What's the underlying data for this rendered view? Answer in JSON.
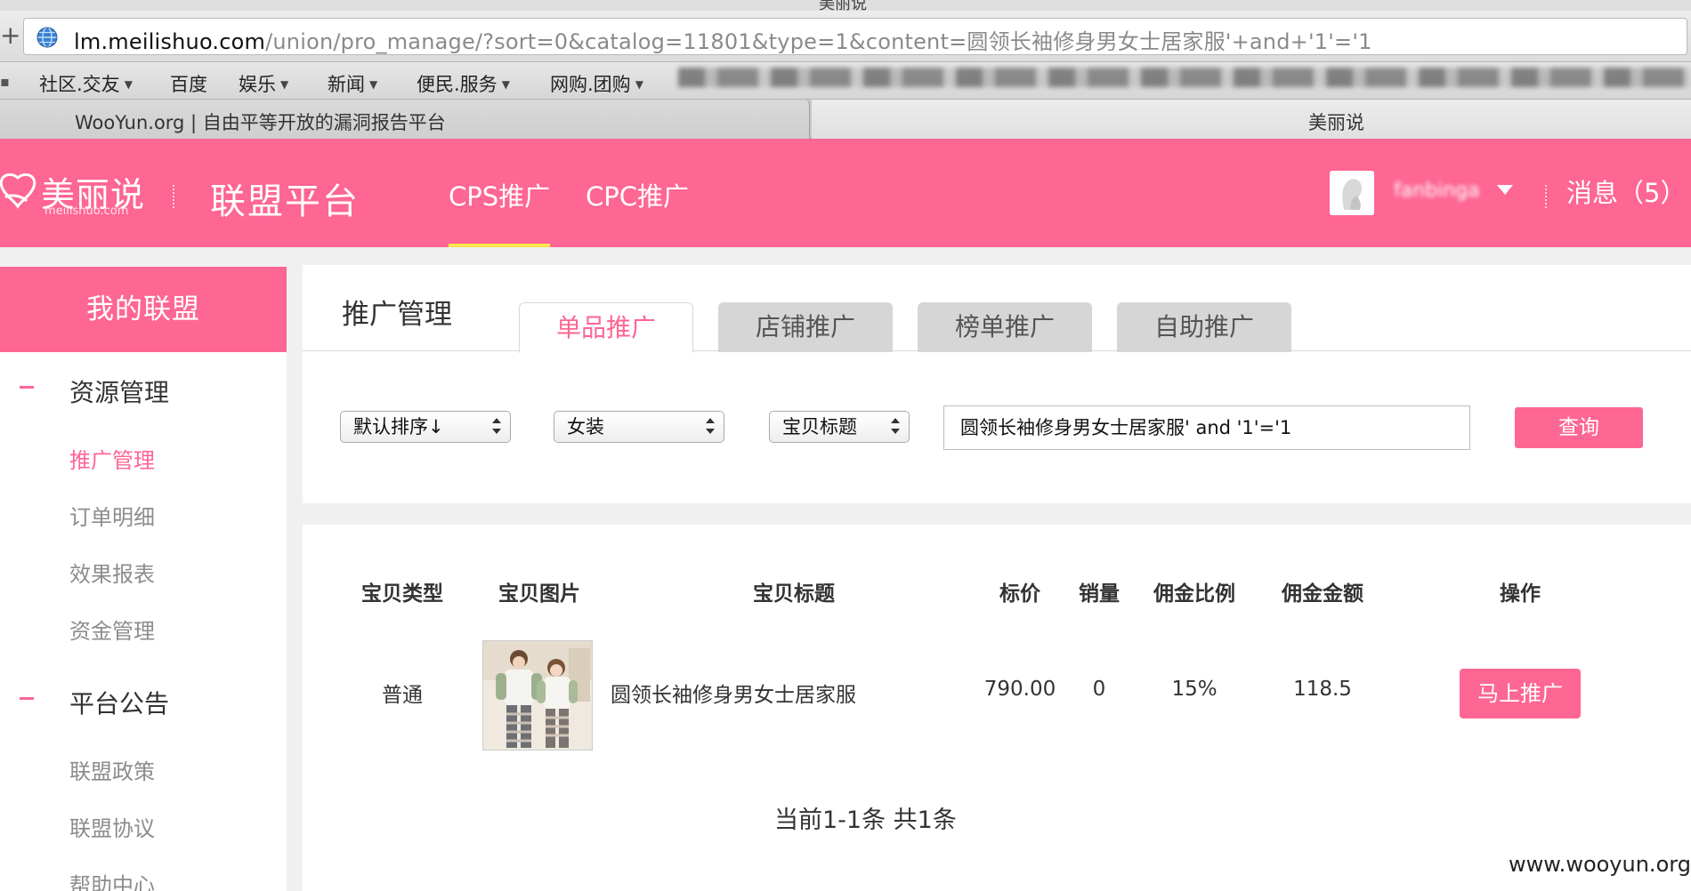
{
  "window": {
    "title": "美丽说"
  },
  "browser": {
    "url_host": "lm.meilishuo.com",
    "url_path": "/union/pro_manage/?sort=0&catalog=11801&type=1&content=圆领长袖修身男女士居家服'+and+'1'='1",
    "bookmarks": [
      "社区.交友",
      "百度",
      "娱乐",
      "新闻",
      "便民.服务",
      "网购.团购"
    ],
    "tabs": [
      {
        "label": "WooYun.org | 自由平等开放的漏洞报告平台"
      },
      {
        "label": "美丽说"
      }
    ]
  },
  "header": {
    "logo_text": "美丽说",
    "logo_sub": "meilishuo.com",
    "platform": "联盟平台",
    "nav": [
      {
        "label": "CPS推广"
      },
      {
        "label": "CPC推广"
      }
    ],
    "username": "fanbinga",
    "messages": "消息（5）",
    "accent": "#fe6694",
    "nav_active_underline": "#ffe44a"
  },
  "sidebar": {
    "title": "我的联盟",
    "groups": [
      {
        "title": "资源管理",
        "items": [
          "推广管理",
          "订单明细",
          "效果报表",
          "资金管理"
        ]
      },
      {
        "title": "平台公告",
        "items": [
          "联盟政策",
          "联盟协议",
          "帮助中心"
        ]
      }
    ],
    "active_item": "推广管理"
  },
  "main": {
    "section_title": "推广管理",
    "tabs": [
      "单品推广",
      "店铺推广",
      "榜单推广",
      "自助推广"
    ],
    "filters": {
      "sort": "默认排序↓",
      "category": "女装",
      "field": "宝贝标题",
      "query": "圆领长袖修身男女士居家服' and '1'='1",
      "search_button": "查询"
    },
    "table": {
      "headers": [
        "宝贝类型",
        "宝贝图片",
        "宝贝标题",
        "标价",
        "销量",
        "佣金比例",
        "佣金金额",
        "操作"
      ],
      "rows": [
        {
          "type": "普通",
          "title": "圆领长袖修身男女士居家服",
          "price": "790.00",
          "sales": "0",
          "commission_rate": "15%",
          "commission": "118.5",
          "action": "马上推广"
        }
      ]
    },
    "pager": "当前1-1条 共1条"
  },
  "watermark": "www.wooyun.org"
}
